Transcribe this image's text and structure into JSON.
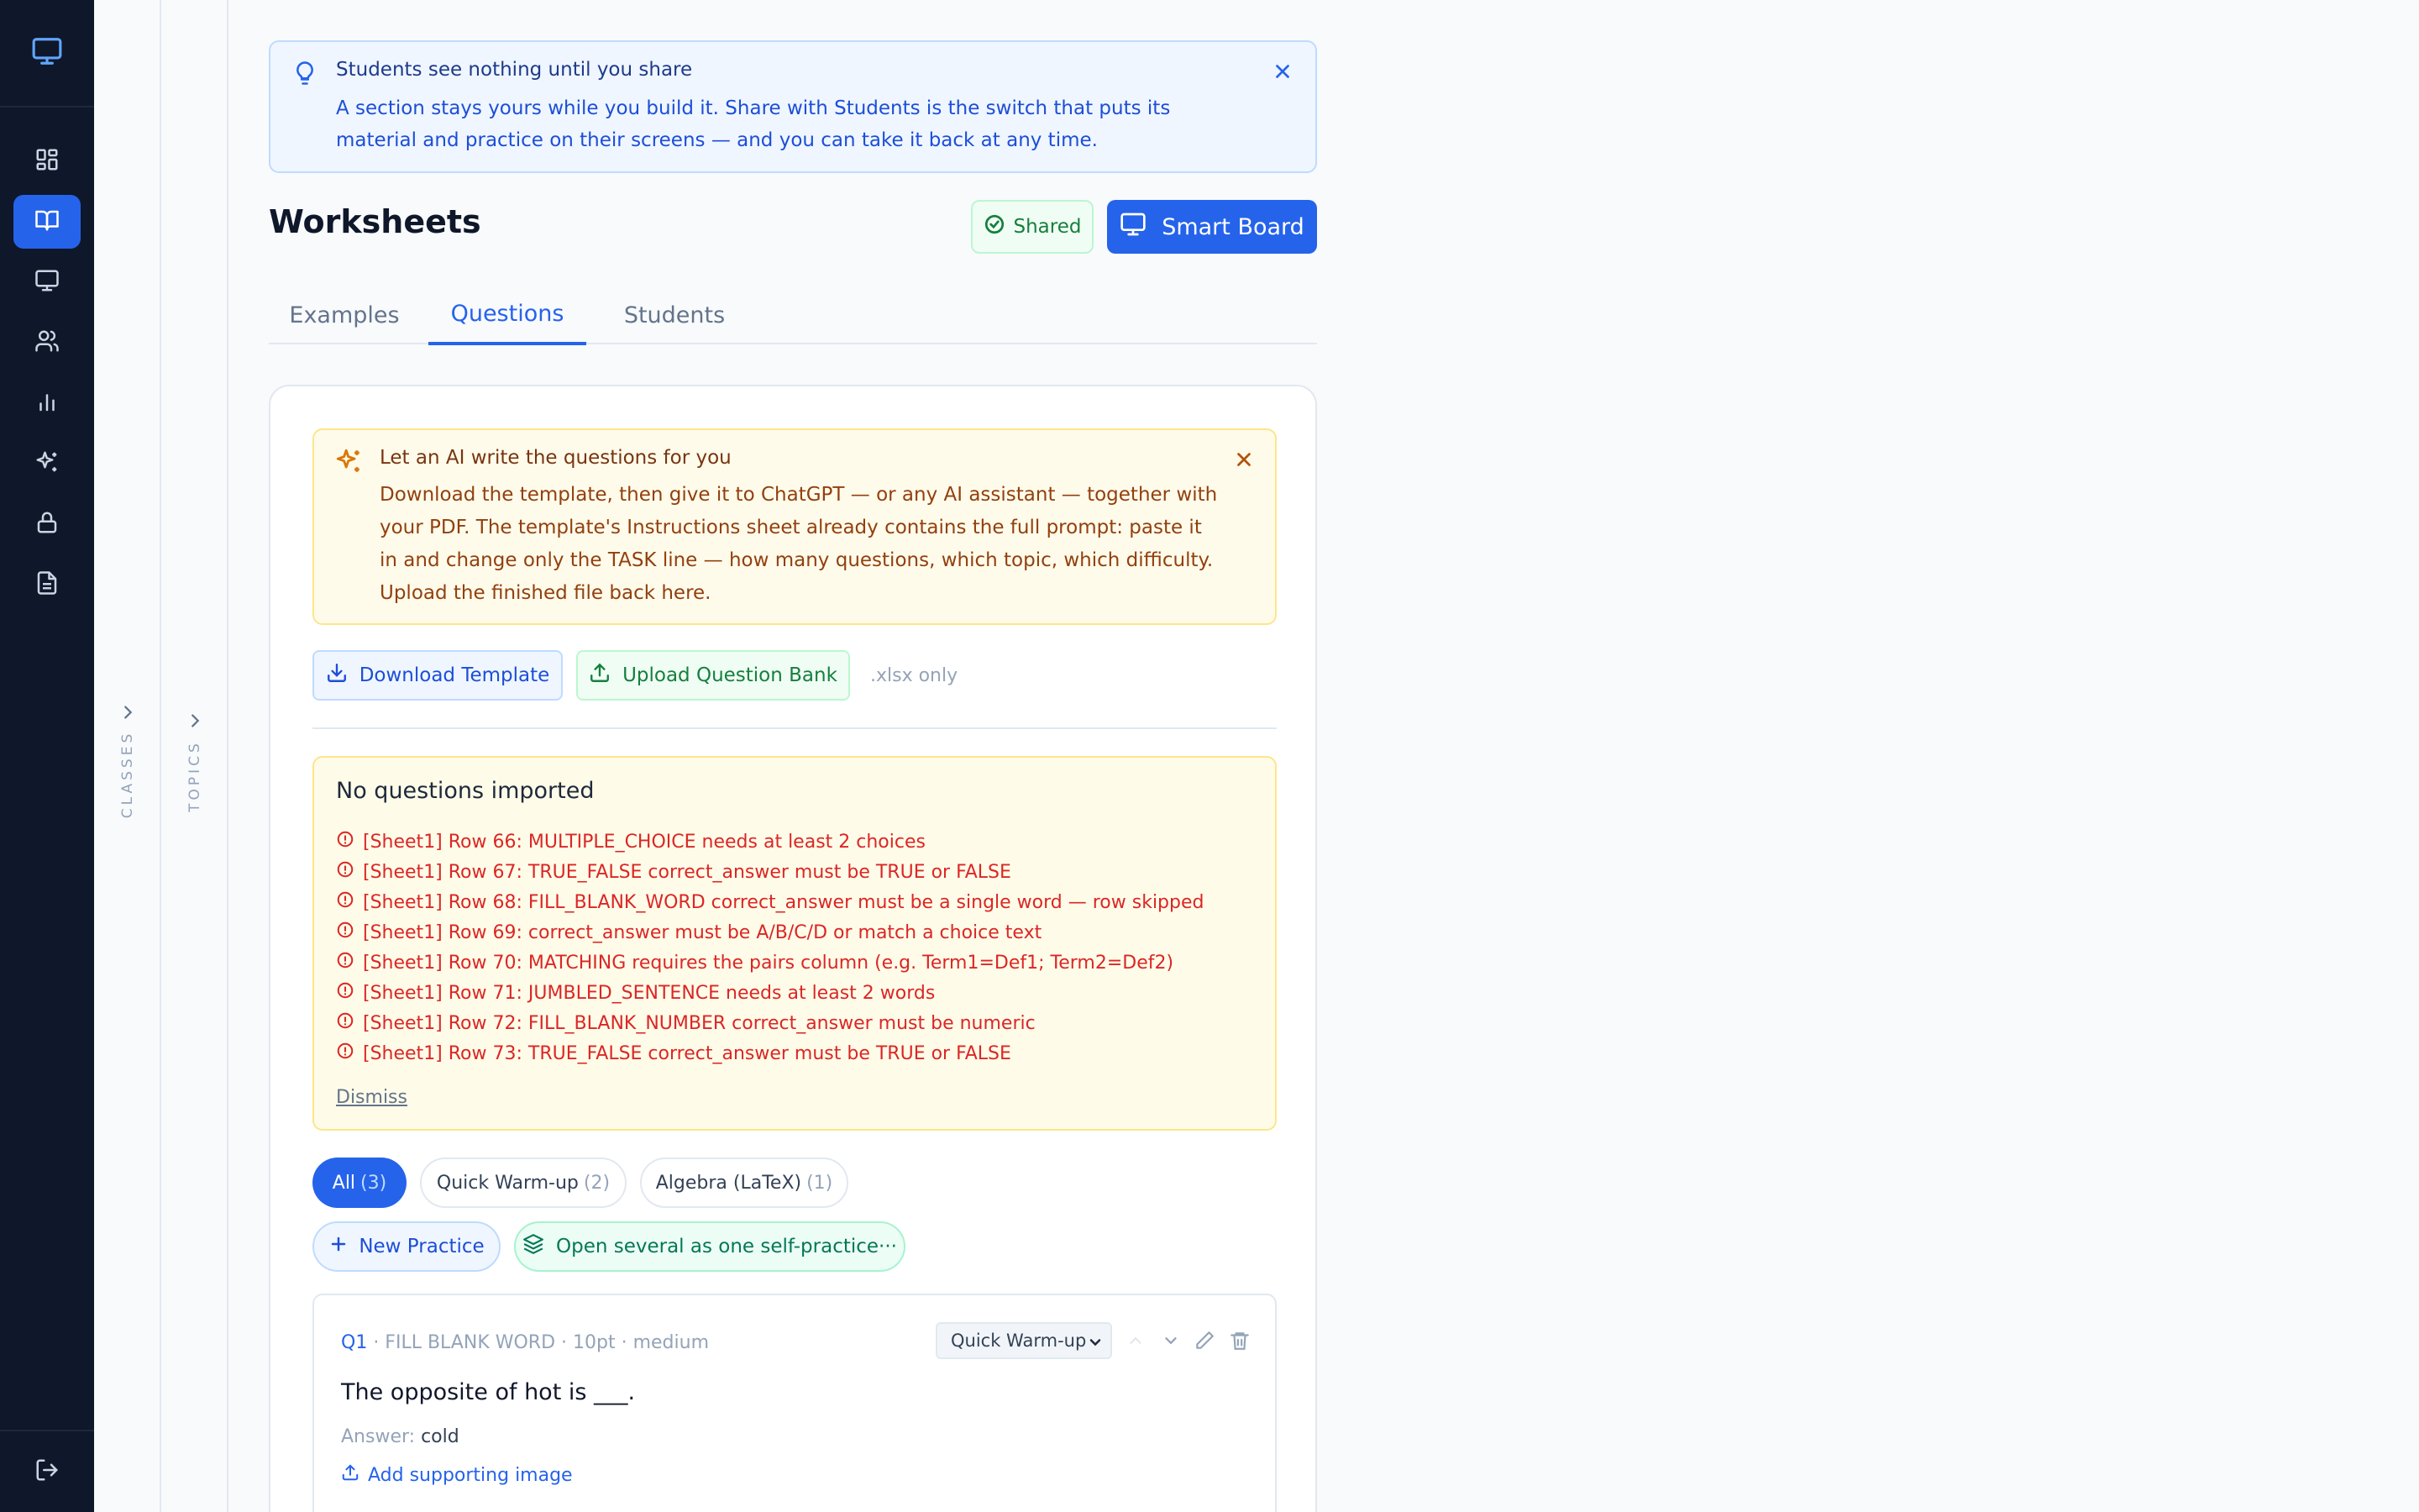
{
  "rail": {
    "logo_icon": "monitor-icon",
    "nav": [
      {
        "icon": "dashboard-icon",
        "active": false
      },
      {
        "icon": "book-open-icon",
        "active": true
      },
      {
        "icon": "monitor-icon",
        "active": false
      },
      {
        "icon": "users-icon",
        "active": false
      },
      {
        "icon": "bar-chart-icon",
        "active": false
      },
      {
        "icon": "sparkles-icon",
        "active": false
      },
      {
        "icon": "lock-icon",
        "active": false
      },
      {
        "icon": "file-text-icon",
        "active": false
      }
    ],
    "logout_icon": "logout-icon"
  },
  "panels": {
    "classes_label": "CLASSES",
    "topics_label": "TOPICS"
  },
  "info_banner": {
    "title": "Students see nothing until you share",
    "text": "A section stays yours while you build it. Share with Students is the switch that puts its material and practice on their screens — and you can take it back at any time."
  },
  "header": {
    "title": "Worksheets",
    "shared_label": "Shared",
    "smart_board_label": "Smart Board"
  },
  "tabs": [
    {
      "label": "Examples",
      "active": false
    },
    {
      "label": "Questions",
      "active": true
    },
    {
      "label": "Students",
      "active": false
    }
  ],
  "ai_banner": {
    "title": "Let an AI write the questions for you",
    "text": "Download the template, then give it to ChatGPT — or any AI assistant — together with your PDF. The template's Instructions sheet already contains the full prompt: paste it in and change only the TASK line — how many questions, which topic, which difficulty. Upload the finished file back here."
  },
  "actions": {
    "download_label": "Download Template",
    "upload_label": "Upload Question Bank",
    "file_note": ".xlsx only"
  },
  "import_errors": {
    "title": "No questions imported",
    "items": [
      "[Sheet1] Row 66: MULTIPLE_CHOICE needs at least 2 choices",
      "[Sheet1] Row 67: TRUE_FALSE correct_answer must be TRUE or FALSE",
      "[Sheet1] Row 68: FILL_BLANK_WORD correct_answer must be a single word — row skipped",
      "[Sheet1] Row 69: correct_answer must be A/B/C/D or match a choice text",
      "[Sheet1] Row 70: MATCHING requires the pairs column (e.g. Term1=Def1; Term2=Def2)",
      "[Sheet1] Row 71: JUMBLED_SENTENCE needs at least 2 words",
      "[Sheet1] Row 72: FILL_BLANK_NUMBER correct_answer must be numeric",
      "[Sheet1] Row 73: TRUE_FALSE correct_answer must be TRUE or FALSE"
    ],
    "dismiss_label": "Dismiss"
  },
  "filters": [
    {
      "label": "All",
      "count": "(3)",
      "active": true
    },
    {
      "label": "Quick Warm-up",
      "count": "(2)",
      "active": false
    },
    {
      "label": "Algebra (LaTeX)",
      "count": "(1)",
      "active": false
    }
  ],
  "practice": {
    "new_label": "New Practice",
    "multi_label": "Open several as one self-practice···"
  },
  "question": {
    "number": "Q1",
    "meta": " · FILL BLANK WORD · 10pt · medium",
    "practice_select": "Quick Warm-up",
    "text": "The opposite of hot is ___.",
    "answer_label": "Answer:",
    "answer_value": "cold",
    "add_image_label": "Add supporting image"
  },
  "colors": {
    "accent": "#2563eb",
    "rail": "#0f172a",
    "error": "#dc2626",
    "success": "#15803d"
  }
}
